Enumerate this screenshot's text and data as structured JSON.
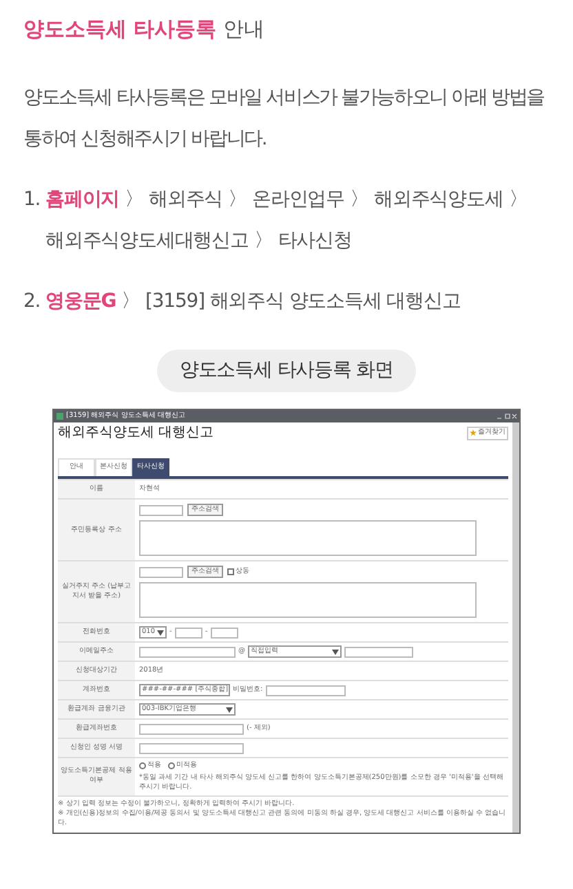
{
  "heading": {
    "highlight": "양도소득세 타사등록",
    "rest": " 안내"
  },
  "intro": "양도소득세 타사등록은 모바일 서비스가 불가능하오니 아래 방법을 통하여 신청해주시기 바랍니다.",
  "steps": [
    {
      "number": "1.",
      "separator": "〉",
      "path": [
        {
          "text": "홈페이지",
          "highlighted": true
        },
        {
          "text": "해외주식",
          "highlighted": false
        },
        {
          "text": "온라인업무",
          "highlighted": false
        },
        {
          "text": "해외주식양도세",
          "highlighted": false
        },
        {
          "text": "해외주식양도세대행신고",
          "highlighted": false
        },
        {
          "text": "타사신청",
          "highlighted": false
        }
      ]
    },
    {
      "number": "2.",
      "separator": "〉",
      "path": [
        {
          "text": "영웅문G",
          "highlighted": true
        },
        {
          "text": "[3159] 해외주식 양도소득세 대행신고",
          "highlighted": false
        }
      ]
    }
  ],
  "screen_label": "양도소득세 타사등록 화면",
  "window": {
    "title": "[3159] 해외주식 양도소득세 대행신고",
    "heading": "해외주식양도세 대행신고",
    "bookmark": "즐겨찾기",
    "tabs": [
      {
        "label": "안내",
        "selected": false
      },
      {
        "label": "본사신청",
        "selected": false
      },
      {
        "label": "타사신청",
        "selected": true
      }
    ],
    "rows": [
      {
        "kind": "text",
        "label": "이름",
        "value": "차현석"
      },
      {
        "kind": "address",
        "label": "주민등록상 주소",
        "button": "주소검색"
      },
      {
        "kind": "address",
        "label": "실거주지 주소 (납부고지서 받을 주소)",
        "button": "주소검색",
        "checkbox": {
          "label": "상동",
          "checked": false
        }
      },
      {
        "kind": "phone",
        "label": "전화번호",
        "select": "010",
        "dash": "-"
      },
      {
        "kind": "email",
        "label": "이메일주소",
        "at": "@",
        "select": "직접입력"
      },
      {
        "kind": "text",
        "label": "신청대상기간",
        "value": "2018년"
      },
      {
        "kind": "account",
        "label": "계좌번호",
        "select": "###-##-### [주식종합]",
        "password_label": "비밀번호:"
      },
      {
        "kind": "select",
        "label": "환급계좌 금융기관",
        "select": "003-IBK기업은행"
      },
      {
        "kind": "input",
        "label": "환급계좌번호",
        "hint": "(- 제외)"
      },
      {
        "kind": "input",
        "label": "신청인 성명 서명"
      },
      {
        "kind": "radio",
        "label": "양도소득기본공제 적용여부",
        "options": [
          {
            "label": "적용",
            "selected": false
          },
          {
            "label": "미적용",
            "selected": false
          }
        ],
        "note": "*동일 과세 기간 내 타사 해외주식 양도세 신고를 한하여 양도소득기본공제(250만원)를 소모한 경우 '미적용'을 선택해 주시기 바랍니다."
      }
    ],
    "notes": [
      "※ 상기 입력 정보는 수정이 불가하오니, 정확하게 입력하여 주시기 바랍니다.",
      "※ 개인(신용)정보의 수집/이용/제공 동의서 및 양도소득세 대행신고 관련 동의에 미동의 하실 경우, 양도세 대행신고 서비스를 이용하실 수 없습니다."
    ]
  }
}
